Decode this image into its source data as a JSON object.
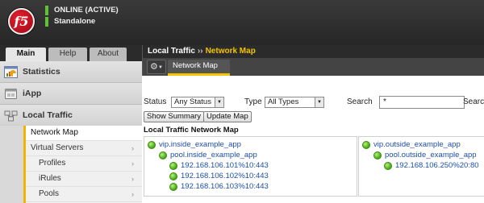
{
  "header": {
    "logo_text": "f5",
    "status": "ONLINE (ACTIVE)",
    "mode": "Standalone",
    "status_color": "#5ec234"
  },
  "nav_tabs": [
    {
      "label": "Main",
      "active": true
    },
    {
      "label": "Help",
      "active": false
    },
    {
      "label": "About",
      "active": false
    }
  ],
  "sidebar": {
    "sections": [
      {
        "label": "Statistics",
        "icon": "statistics-icon"
      },
      {
        "label": "iApp",
        "icon": "iapp-icon"
      },
      {
        "label": "Local Traffic",
        "icon": "local-traffic-icon"
      }
    ],
    "items": [
      {
        "label": "Network Map",
        "active": true,
        "arrow": ""
      },
      {
        "label": "Virtual Servers",
        "active": false,
        "arrow": "›"
      },
      {
        "label": "Profiles",
        "active": false,
        "arrow": "›"
      },
      {
        "label": "iRules",
        "active": false,
        "arrow": "›"
      },
      {
        "label": "Pools",
        "active": false,
        "arrow": "›"
      }
    ]
  },
  "breadcrumb": {
    "parent": "Local Traffic",
    "separator": "››",
    "current": "Network Map"
  },
  "toolbar": {
    "gear_icon": "⚙",
    "caret": "▼",
    "page_tab": "Network Map"
  },
  "filters": {
    "status_label": "Status",
    "status_value": "Any Status",
    "type_label": "Type",
    "type_value": "All Types",
    "search_label": "Search",
    "search_value": "*",
    "search_label_2": "Searc"
  },
  "buttons": {
    "show_summary": "Show Summary",
    "update_map": "Update Map"
  },
  "map_title": "Local Traffic Network Map",
  "map": {
    "left": {
      "virtual_server": "vip.inside_example_app",
      "pool": "pool.inside_example_app",
      "members": [
        "192.168.106.101%10:443",
        "192.168.106.102%10:443",
        "192.168.106.103%10:443"
      ]
    },
    "right": {
      "virtual_server": "vip.outside_example_app",
      "pool": "pool.outside_example_app",
      "members": [
        "192.168.106.250%20:80"
      ]
    },
    "status_color": "#44a814"
  }
}
